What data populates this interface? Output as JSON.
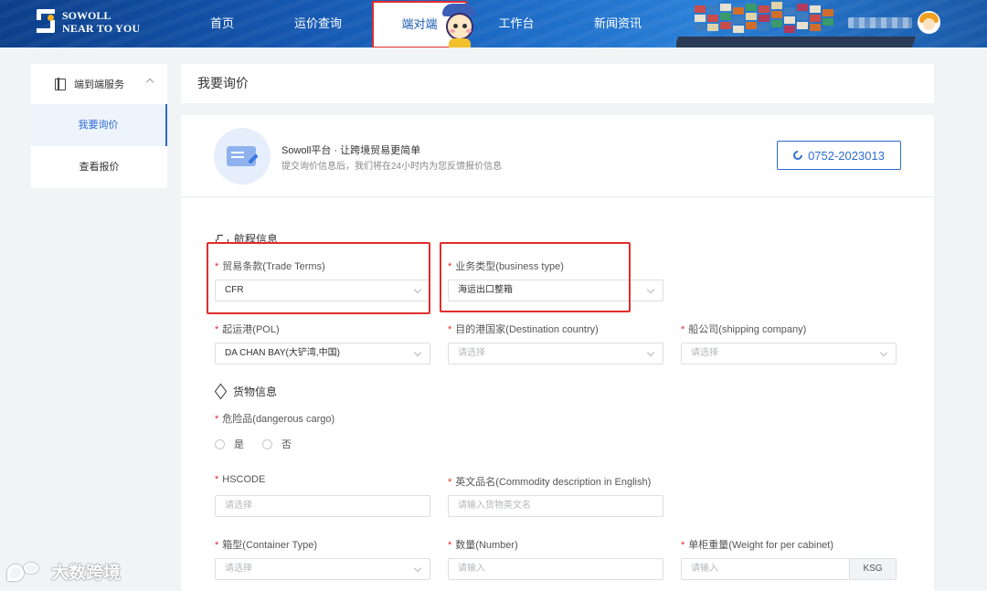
{
  "header": {
    "logo": {
      "line1": "SOWOLL",
      "line2": "NEAR TO YOU"
    },
    "nav": [
      {
        "label": "首页"
      },
      {
        "label": "运价查询"
      },
      {
        "label": "端对端"
      },
      {
        "label": "工作台"
      },
      {
        "label": "新闻资讯"
      }
    ],
    "active_nav": "端对端"
  },
  "sidebar": {
    "group_title": "端到端服务",
    "items": [
      {
        "label": "我要询价",
        "active": true
      },
      {
        "label": "查看报价",
        "active": false
      }
    ]
  },
  "page_title": "我要询价",
  "intro": {
    "headline": "Sowoll平台 · 让跨境贸易更简单",
    "subtext": "提交询价信息后，我们将在24小时内为您反馈报价信息",
    "phone": "0752-2023013"
  },
  "sections": {
    "voyage": "航程信息",
    "cargo": "货物信息"
  },
  "fields": {
    "trade_terms": {
      "label": "贸易条款(Trade Terms)",
      "value": "CFR"
    },
    "business_type": {
      "label": "业务类型(business type)",
      "value": "海运出口整箱"
    },
    "pol": {
      "label": "起运港(POL)",
      "value": "DA CHAN BAY(大铲湾,中国)"
    },
    "destination_country": {
      "label": "目的港国家(Destination country)",
      "placeholder": "请选择"
    },
    "shipping_company": {
      "label": "船公司(shipping company)",
      "placeholder": "请选择"
    },
    "dangerous_cargo": {
      "label": "危险品(dangerous cargo)",
      "options": [
        "是",
        "否"
      ]
    },
    "hscode": {
      "label": "HSCODE",
      "placeholder": "请选择"
    },
    "commodity_en": {
      "label": "英文品名(Commodity description in English)",
      "placeholder": "请输入货物英文名"
    },
    "container_type": {
      "label": "箱型(Container Type)",
      "placeholder": "请选择"
    },
    "number": {
      "label": "数量(Number)",
      "placeholder": "请输入"
    },
    "weight": {
      "label": "单柜重量(Weight for per cabinet)",
      "placeholder": "请输入",
      "unit": "KSG"
    }
  },
  "watermark": "大数跨境",
  "colors": {
    "primary": "#2e6cd1",
    "highlight": "#e02c2c",
    "header": "#1557b0"
  }
}
